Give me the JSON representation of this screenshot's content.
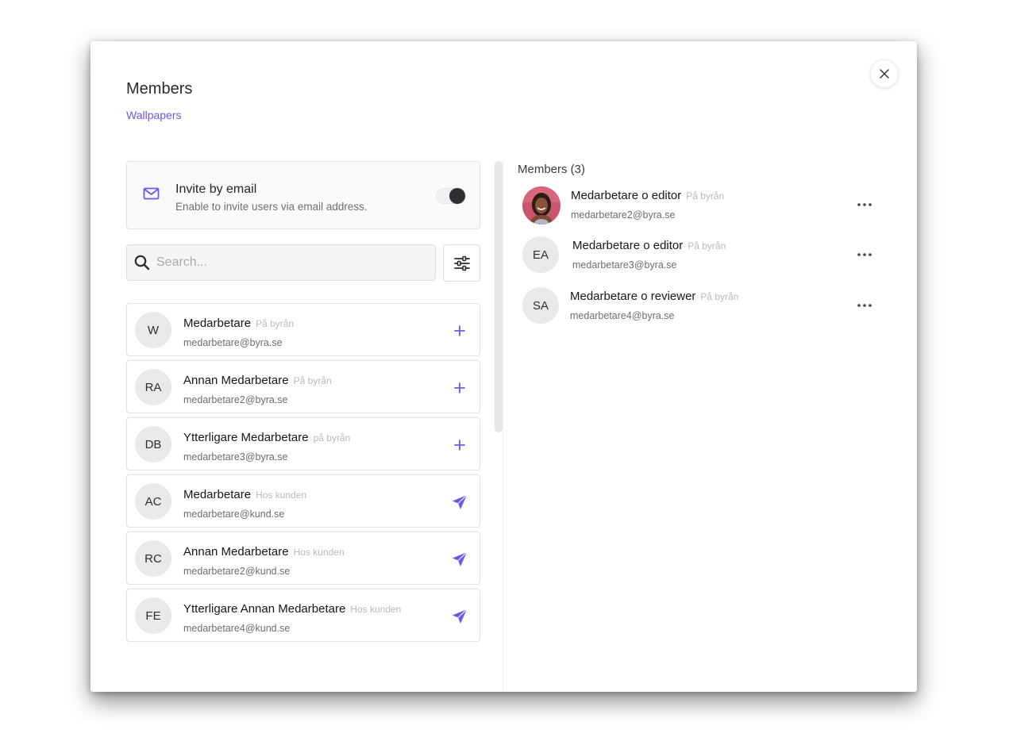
{
  "dialog": {
    "title": "Members",
    "subtitle": "Wallpapers",
    "close_icon": "close-icon"
  },
  "invite": {
    "icon": "mail-icon",
    "title": "Invite by email",
    "description": "Enable to invite users via email address.",
    "enabled": false
  },
  "search": {
    "placeholder": "Search...",
    "value": "",
    "icon": "search-icon",
    "filter_icon": "sliders-icon"
  },
  "users": [
    {
      "initials": "W",
      "name": "Medarbetare",
      "tag": "På byrån",
      "email": "medarbetare@byra.se",
      "action": "plus-icon"
    },
    {
      "initials": "RA",
      "name": "Annan Medarbetare",
      "tag": "På byrån",
      "email": "medarbetare2@byra.se",
      "action": "plus-icon"
    },
    {
      "initials": "DB",
      "name": "Ytterligare Medarbetare",
      "tag": "på byrån",
      "email": "medarbetare3@byra.se",
      "action": "plus-icon"
    },
    {
      "initials": "AC",
      "name": "Medarbetare",
      "tag": "Hos kunden",
      "email": "medarbetare@kund.se",
      "action": "send-icon"
    },
    {
      "initials": "RC",
      "name": "Annan Medarbetare",
      "tag": "Hos kunden",
      "email": "medarbetare2@kund.se",
      "action": "send-icon"
    },
    {
      "initials": "FE",
      "name": "Ytterligare Annan Medarbetare",
      "tag": "Hos kunden",
      "email": "medarbetare4@kund.se",
      "action": "send-icon"
    }
  ],
  "members": {
    "heading": "Members (3)",
    "items": [
      {
        "avatar": "photo",
        "initials": "",
        "name": "Medarbetare o editor",
        "tag": "På byrån",
        "email": "medarbetare2@byra.se",
        "more_icon": "more-icon"
      },
      {
        "avatar": "initials",
        "initials": "EA",
        "name": "Medarbetare o editor",
        "tag": "På byrån",
        "email": "medarbetare3@byra.se",
        "more_icon": "more-icon"
      },
      {
        "avatar": "initials",
        "initials": "SA",
        "name": "Medarbetare o reviewer",
        "tag": "På byrån",
        "email": "medarbetare4@byra.se",
        "more_icon": "more-icon"
      }
    ]
  },
  "colors": {
    "accent": "#6b57e8",
    "avatar_bg": "#e9e9ec",
    "border": "#e2e2e6"
  }
}
